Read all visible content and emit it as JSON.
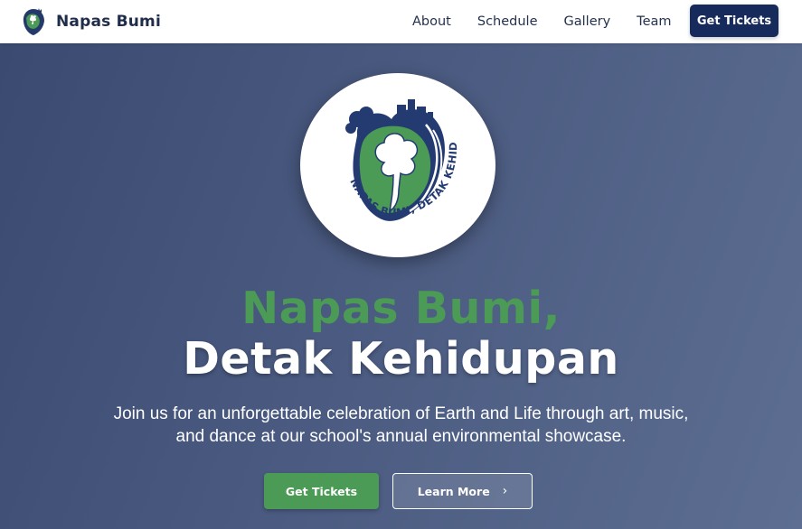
{
  "brand": {
    "name": "Napas Bumi",
    "logo_icon": "napas-bumi-logo-icon"
  },
  "nav": {
    "links": [
      "About",
      "Schedule",
      "Gallery",
      "Team"
    ],
    "cta_label": "Get Tickets"
  },
  "hero": {
    "logo_text": "NAPAS BUMI, DETAK KEHIDUPAN",
    "title_line1": "Napas Bumi,",
    "title_line2": "Detak Kehidupan",
    "subtitle": "Join us for an unforgettable celebration of Earth and Life through art, music, and dance at our school's annual environmental showcase.",
    "primary_button": "Get Tickets",
    "secondary_button": "Learn More",
    "secondary_icon": "chevron-right-icon"
  },
  "colors": {
    "accent_green": "#4b9a55",
    "navy": "#172a5c",
    "hero_bg": "#3f5075"
  }
}
